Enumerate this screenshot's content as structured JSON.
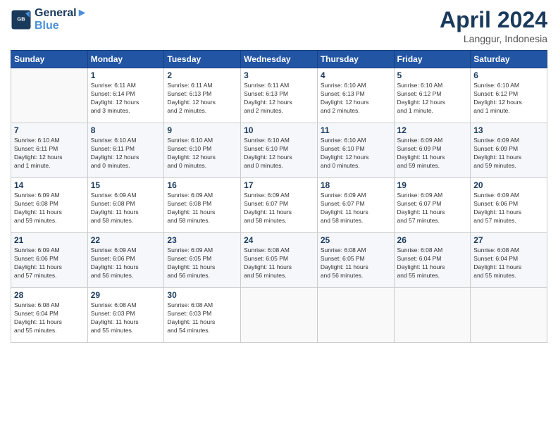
{
  "header": {
    "logo_line1": "General",
    "logo_line2": "Blue",
    "month": "April 2024",
    "location": "Langgur, Indonesia"
  },
  "weekdays": [
    "Sunday",
    "Monday",
    "Tuesday",
    "Wednesday",
    "Thursday",
    "Friday",
    "Saturday"
  ],
  "weeks": [
    [
      {
        "day": "",
        "info": ""
      },
      {
        "day": "1",
        "info": "Sunrise: 6:11 AM\nSunset: 6:14 PM\nDaylight: 12 hours\nand 3 minutes."
      },
      {
        "day": "2",
        "info": "Sunrise: 6:11 AM\nSunset: 6:13 PM\nDaylight: 12 hours\nand 2 minutes."
      },
      {
        "day": "3",
        "info": "Sunrise: 6:11 AM\nSunset: 6:13 PM\nDaylight: 12 hours\nand 2 minutes."
      },
      {
        "day": "4",
        "info": "Sunrise: 6:10 AM\nSunset: 6:13 PM\nDaylight: 12 hours\nand 2 minutes."
      },
      {
        "day": "5",
        "info": "Sunrise: 6:10 AM\nSunset: 6:12 PM\nDaylight: 12 hours\nand 1 minute."
      },
      {
        "day": "6",
        "info": "Sunrise: 6:10 AM\nSunset: 6:12 PM\nDaylight: 12 hours\nand 1 minute."
      }
    ],
    [
      {
        "day": "7",
        "info": "Sunrise: 6:10 AM\nSunset: 6:11 PM\nDaylight: 12 hours\nand 1 minute."
      },
      {
        "day": "8",
        "info": "Sunrise: 6:10 AM\nSunset: 6:11 PM\nDaylight: 12 hours\nand 0 minutes."
      },
      {
        "day": "9",
        "info": "Sunrise: 6:10 AM\nSunset: 6:10 PM\nDaylight: 12 hours\nand 0 minutes."
      },
      {
        "day": "10",
        "info": "Sunrise: 6:10 AM\nSunset: 6:10 PM\nDaylight: 12 hours\nand 0 minutes."
      },
      {
        "day": "11",
        "info": "Sunrise: 6:10 AM\nSunset: 6:10 PM\nDaylight: 12 hours\nand 0 minutes."
      },
      {
        "day": "12",
        "info": "Sunrise: 6:09 AM\nSunset: 6:09 PM\nDaylight: 11 hours\nand 59 minutes."
      },
      {
        "day": "13",
        "info": "Sunrise: 6:09 AM\nSunset: 6:09 PM\nDaylight: 11 hours\nand 59 minutes."
      }
    ],
    [
      {
        "day": "14",
        "info": "Sunrise: 6:09 AM\nSunset: 6:08 PM\nDaylight: 11 hours\nand 59 minutes."
      },
      {
        "day": "15",
        "info": "Sunrise: 6:09 AM\nSunset: 6:08 PM\nDaylight: 11 hours\nand 58 minutes."
      },
      {
        "day": "16",
        "info": "Sunrise: 6:09 AM\nSunset: 6:08 PM\nDaylight: 11 hours\nand 58 minutes."
      },
      {
        "day": "17",
        "info": "Sunrise: 6:09 AM\nSunset: 6:07 PM\nDaylight: 11 hours\nand 58 minutes."
      },
      {
        "day": "18",
        "info": "Sunrise: 6:09 AM\nSunset: 6:07 PM\nDaylight: 11 hours\nand 58 minutes."
      },
      {
        "day": "19",
        "info": "Sunrise: 6:09 AM\nSunset: 6:07 PM\nDaylight: 11 hours\nand 57 minutes."
      },
      {
        "day": "20",
        "info": "Sunrise: 6:09 AM\nSunset: 6:06 PM\nDaylight: 11 hours\nand 57 minutes."
      }
    ],
    [
      {
        "day": "21",
        "info": "Sunrise: 6:09 AM\nSunset: 6:06 PM\nDaylight: 11 hours\nand 57 minutes."
      },
      {
        "day": "22",
        "info": "Sunrise: 6:09 AM\nSunset: 6:06 PM\nDaylight: 11 hours\nand 56 minutes."
      },
      {
        "day": "23",
        "info": "Sunrise: 6:09 AM\nSunset: 6:05 PM\nDaylight: 11 hours\nand 56 minutes."
      },
      {
        "day": "24",
        "info": "Sunrise: 6:08 AM\nSunset: 6:05 PM\nDaylight: 11 hours\nand 56 minutes."
      },
      {
        "day": "25",
        "info": "Sunrise: 6:08 AM\nSunset: 6:05 PM\nDaylight: 11 hours\nand 56 minutes."
      },
      {
        "day": "26",
        "info": "Sunrise: 6:08 AM\nSunset: 6:04 PM\nDaylight: 11 hours\nand 55 minutes."
      },
      {
        "day": "27",
        "info": "Sunrise: 6:08 AM\nSunset: 6:04 PM\nDaylight: 11 hours\nand 55 minutes."
      }
    ],
    [
      {
        "day": "28",
        "info": "Sunrise: 6:08 AM\nSunset: 6:04 PM\nDaylight: 11 hours\nand 55 minutes."
      },
      {
        "day": "29",
        "info": "Sunrise: 6:08 AM\nSunset: 6:03 PM\nDaylight: 11 hours\nand 55 minutes."
      },
      {
        "day": "30",
        "info": "Sunrise: 6:08 AM\nSunset: 6:03 PM\nDaylight: 11 hours\nand 54 minutes."
      },
      {
        "day": "",
        "info": ""
      },
      {
        "day": "",
        "info": ""
      },
      {
        "day": "",
        "info": ""
      },
      {
        "day": "",
        "info": ""
      }
    ]
  ]
}
